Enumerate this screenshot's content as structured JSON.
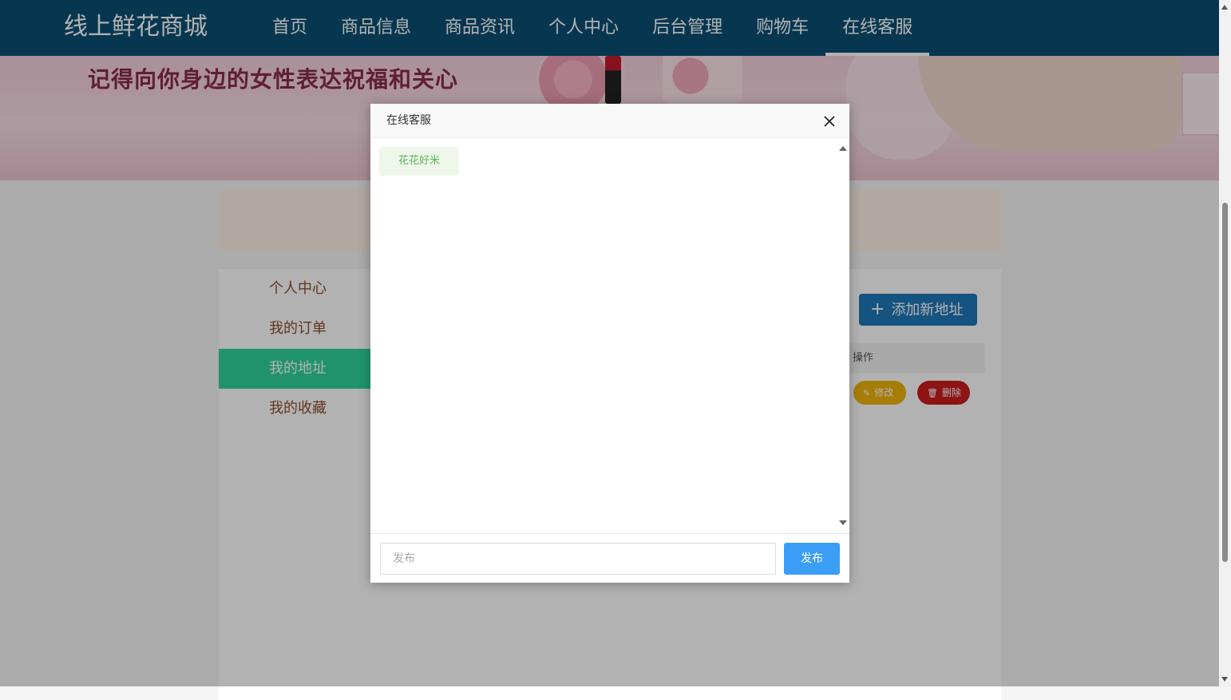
{
  "header": {
    "logo": "线上鲜花商城",
    "nav": [
      {
        "label": "首页"
      },
      {
        "label": "商品信息"
      },
      {
        "label": "商品资讯"
      },
      {
        "label": "个人中心"
      },
      {
        "label": "后台管理"
      },
      {
        "label": "购物车"
      },
      {
        "label": "在线客服",
        "active": true
      }
    ]
  },
  "banner": {
    "slogan": "记得向你身边的女性表达祝福和关心"
  },
  "sidebar": {
    "items": [
      {
        "label": "个人中心"
      },
      {
        "label": "我的订单"
      },
      {
        "label": "我的地址",
        "active": true
      },
      {
        "label": "我的收藏"
      }
    ]
  },
  "address": {
    "add_button": "添加新地址",
    "table_header": "操作",
    "edit_label": "修改",
    "delete_label": "删除"
  },
  "dialog": {
    "title": "在线客服",
    "messages": [
      {
        "text": "花花好米"
      }
    ],
    "input_placeholder": "发布",
    "send_label": "发布"
  },
  "colors": {
    "nav_bg": "#0b4f73",
    "sidebar_active": "#2fd39c",
    "add_button": "#1f78b8",
    "edit_button": "#f0b40e",
    "delete_button": "#cc1c1c",
    "send_button": "#3a9ef6",
    "message_text": "#59b34f"
  }
}
